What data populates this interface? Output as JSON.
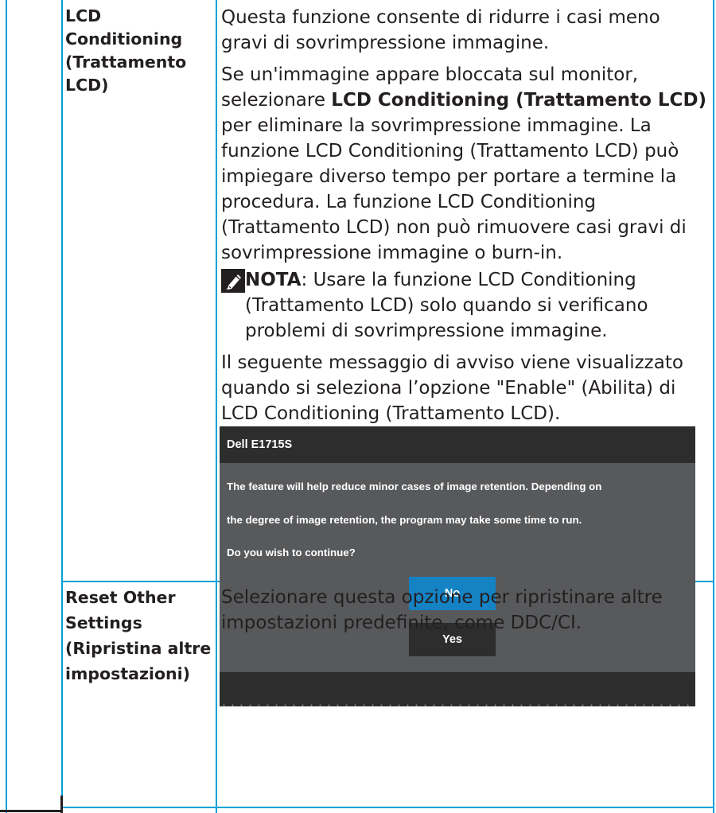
{
  "row1": {
    "label": "LCD Conditioning (Trattamento LCD)",
    "p1": "Questa funzione consente di ridurre i casi meno gravi di sovrimpressione immagine.",
    "p2_before": "Se un'immagine appare bloccata sul monitor, selezionare ",
    "p2_bold": "LCD Conditioning (Trattamento LCD)",
    "p2_after": " per eliminare la sovrimpressione immagine. La funzione LCD Conditioning (Trattamento LCD) può impiegare diverso tempo per portare a termine la procedura. La funzione LCD Conditioning (Trattamento LCD) non può rimuovere casi gravi di sovrimpressione immagine o burn-in.",
    "note_label": "NOTA",
    "note_text": ": Usare la funzione LCD Conditioning (Trattamento LCD) solo quando si verificano problemi di sovrimpressione immagine.",
    "p3": "Il seguente messaggio di avviso viene visualizzato quando si seleziona l’opzione \"Enable\" (Abilita) di LCD Conditioning (Trattamento LCD)."
  },
  "dialog": {
    "title": "Dell E1715S",
    "line1": "The feature will help reduce minor cases of image retention. Depending on",
    "line2": "the degree of image retention, the program may take some time to run.",
    "line3": "Do you wish to continue?",
    "no_label": "No",
    "yes_label": "Yes",
    "colors": {
      "header": "#2d2d2d",
      "body": "#58595b",
      "no_button": "#1582c4",
      "yes_button": "#2d2d2d",
      "text": "#ffffff"
    }
  },
  "row2": {
    "label_line1": "Reset Other",
    "label_line2": "Settings",
    "label_line3": "(Ripristina altre",
    "label_line4": "impostazioni)",
    "text": "Selezionare questa opzione per ripristinare altre impostazioni predefinite, come DDC/CI."
  },
  "theme": {
    "rule_color": "#00a2d6",
    "text_color": "#231f20"
  },
  "icons": {
    "note": "pencil-note-icon"
  }
}
